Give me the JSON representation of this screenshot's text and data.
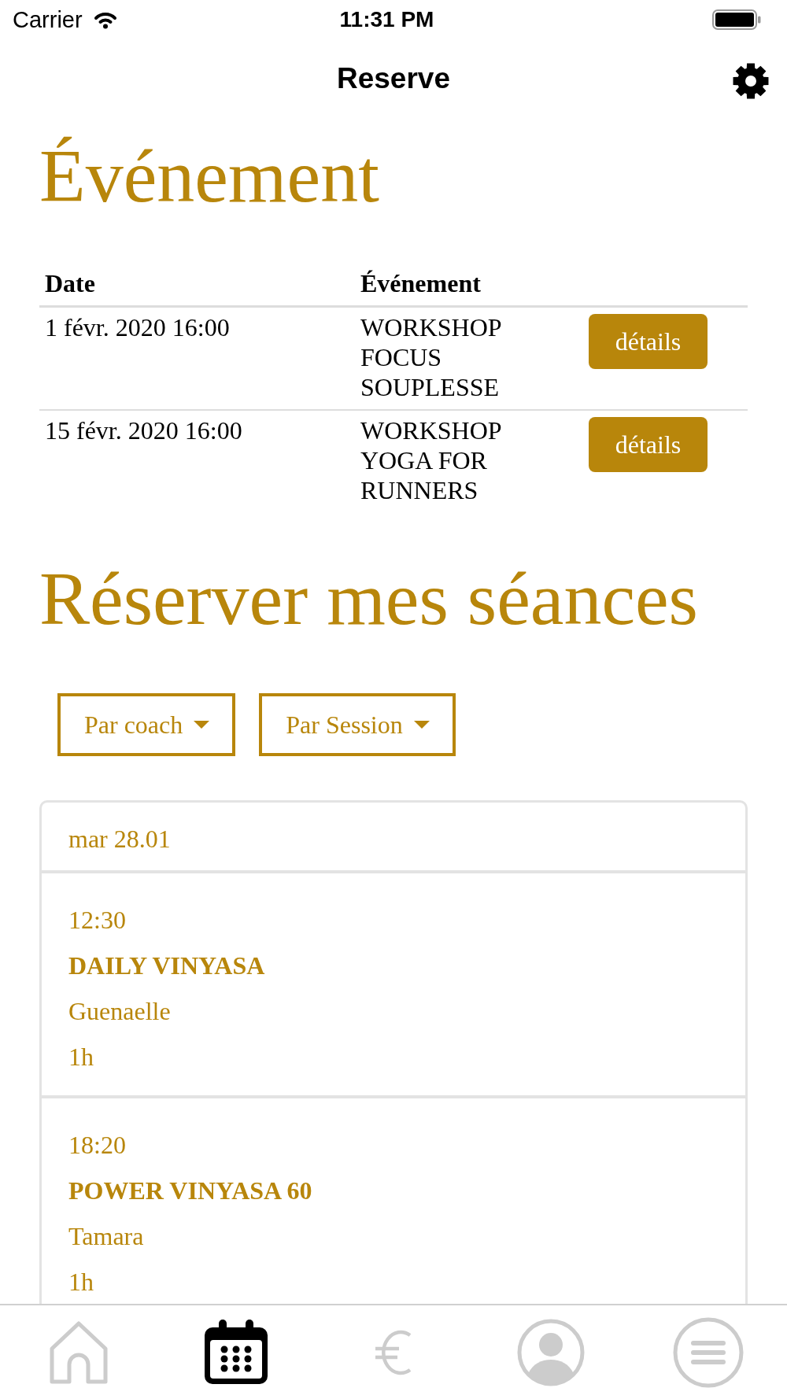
{
  "status_bar": {
    "carrier": "Carrier",
    "time": "11:31 PM"
  },
  "nav_bar": {
    "title": "Reserve"
  },
  "events": {
    "title": "Événement",
    "columns": [
      "Date",
      "Événement"
    ],
    "rows": [
      {
        "date": "1 févr. 2020 16:00",
        "event": "WORKSHOP FOCUS SOUPLESSE",
        "button": "détails"
      },
      {
        "date": "15 févr. 2020 16:00",
        "event": "WORKSHOP YOGA FOR RUNNERS",
        "button": "détails"
      }
    ]
  },
  "booking": {
    "title": "Réserver mes séances",
    "filters": [
      {
        "label": "Par coach"
      },
      {
        "label": "Par Session"
      }
    ],
    "day": {
      "label": "mar 28.01",
      "sessions": [
        {
          "time": "12:30",
          "name": "DAILY VINYASA",
          "coach": "Guenaelle",
          "duration": "1h"
        },
        {
          "time": "18:20",
          "name": "POWER VINYASA 60",
          "coach": "Tamara",
          "duration": "1h"
        }
      ]
    }
  },
  "tab_bar": [
    {
      "selected": false
    },
    {
      "selected": true
    },
    {
      "selected": false
    },
    {
      "selected": false
    },
    {
      "selected": false
    }
  ]
}
